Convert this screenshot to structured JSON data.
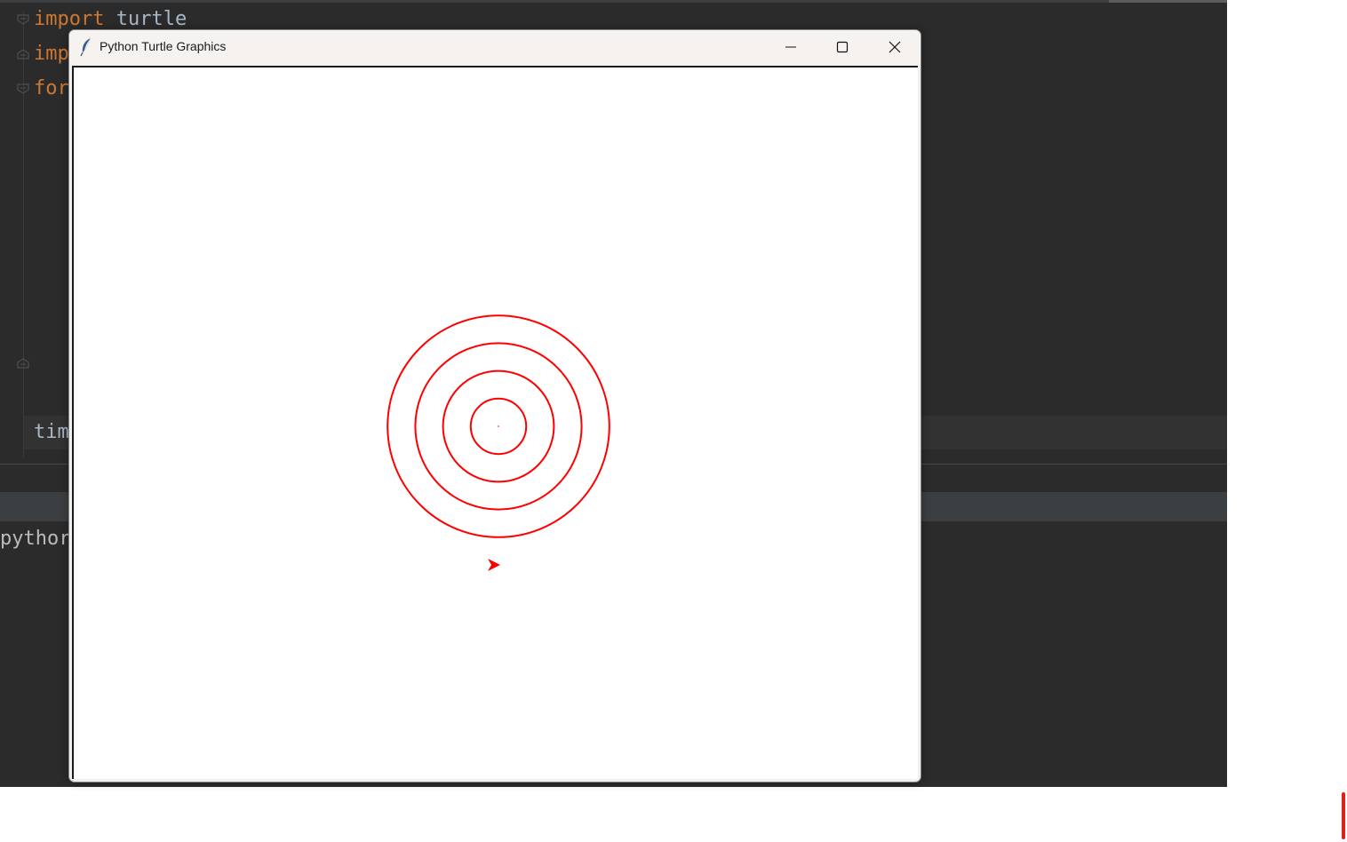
{
  "ide": {
    "code_lines": [
      {
        "keyword": "import",
        "rest": " turtle"
      },
      {
        "keyword": "imp",
        "rest": ""
      },
      {
        "keyword": "for",
        "rest": ""
      }
    ],
    "current_line_text": "tim",
    "console_text": "pythor"
  },
  "turtle_window": {
    "title": "Python Turtle Graphics",
    "app_icon": "feather-icon",
    "buttons": {
      "minimize": "minimize-icon",
      "maximize": "maximize-icon",
      "close": "close-icon"
    },
    "drawing": {
      "pen_color": "#ff0000",
      "circle_count": 4,
      "turtle_heading": "east"
    }
  },
  "colors": {
    "ide_background": "#2b2b2b",
    "keyword": "#cc7832",
    "code_text": "#a9b7c6",
    "accent_red": "#e0211b"
  }
}
